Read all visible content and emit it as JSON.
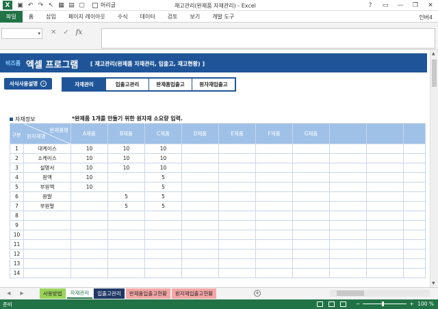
{
  "window": {
    "app_letter": "X",
    "title": "재고관리(완제품 자재관리) - Excel",
    "qat_checkbox_label": "머리글",
    "buttons": [
      "?",
      "▭",
      "—",
      "❐",
      "✕"
    ]
  },
  "ribbon": {
    "file": "파일",
    "tabs": [
      "홈",
      "삽입",
      "페이지 레이아웃",
      "수식",
      "데이터",
      "검토",
      "보기",
      "개발 도구"
    ],
    "user": "인버4"
  },
  "formula_bar": {
    "name_box": "",
    "cancel": "✕",
    "enter": "✓",
    "fx": "fx",
    "value": ""
  },
  "banner": {
    "logo_small": "비즈폼",
    "title": "엑셀 프로그램",
    "subtitle": "[ 재고관리(완제품 자재관리, 입출고, 재고현황) ]"
  },
  "help_button": {
    "label": "서식사용설명",
    "icon": "›"
  },
  "nav_buttons": [
    {
      "label": "자재관리",
      "active": true
    },
    {
      "label": "입출고관리",
      "active": false
    },
    {
      "label": "완제품입출고",
      "active": false
    },
    {
      "label": "원자재입출고",
      "active": false
    }
  ],
  "section": {
    "label": "자재정보",
    "note": "*완제품 1개를 만들기 위한 원자재 소요량 입력."
  },
  "table": {
    "corner_top": "완제품명",
    "corner_bottom": "원자재명",
    "corner_gubun": "구분",
    "product_columns": [
      "A제품",
      "B제품",
      "C제품",
      "D제품",
      "E제품",
      "F제품",
      "G제품",
      "",
      "",
      ""
    ],
    "rows": [
      {
        "no": "1",
        "name": "대케이스",
        "vals": [
          "10",
          "10",
          "10",
          "",
          "",
          "",
          "",
          "",
          "",
          ""
        ]
      },
      {
        "no": "2",
        "name": "소케이스",
        "vals": [
          "10",
          "10",
          "10",
          "",
          "",
          "",
          "",
          "",
          "",
          ""
        ]
      },
      {
        "no": "3",
        "name": "설명서",
        "vals": [
          "10",
          "10",
          "10",
          "",
          "",
          "",
          "",
          "",
          "",
          ""
        ]
      },
      {
        "no": "4",
        "name": "원액",
        "vals": [
          "10",
          "",
          "5",
          "",
          "",
          "",
          "",
          "",
          "",
          ""
        ]
      },
      {
        "no": "5",
        "name": "부원액",
        "vals": [
          "10",
          "",
          "5",
          "",
          "",
          "",
          "",
          "",
          "",
          ""
        ]
      },
      {
        "no": "6",
        "name": "원말",
        "vals": [
          "",
          "5",
          "5",
          "",
          "",
          "",
          "",
          "",
          "",
          ""
        ]
      },
      {
        "no": "7",
        "name": "부원말",
        "vals": [
          "",
          "5",
          "5",
          "",
          "",
          "",
          "",
          "",
          "",
          ""
        ]
      },
      {
        "no": "8",
        "name": "",
        "vals": [
          "",
          "",
          "",
          "",
          "",
          "",
          "",
          "",
          "",
          ""
        ]
      },
      {
        "no": "9",
        "name": "",
        "vals": [
          "",
          "",
          "",
          "",
          "",
          "",
          "",
          "",
          "",
          ""
        ]
      },
      {
        "no": "10",
        "name": "",
        "vals": [
          "",
          "",
          "",
          "",
          "",
          "",
          "",
          "",
          "",
          ""
        ]
      },
      {
        "no": "11",
        "name": "",
        "vals": [
          "",
          "",
          "",
          "",
          "",
          "",
          "",
          "",
          "",
          ""
        ]
      },
      {
        "no": "12",
        "name": "",
        "vals": [
          "",
          "",
          "",
          "",
          "",
          "",
          "",
          "",
          "",
          ""
        ]
      },
      {
        "no": "13",
        "name": "",
        "vals": [
          "",
          "",
          "",
          "",
          "",
          "",
          "",
          "",
          "",
          ""
        ]
      },
      {
        "no": "14",
        "name": "",
        "vals": [
          "",
          "",
          "",
          "",
          "",
          "",
          "",
          "",
          "",
          ""
        ]
      }
    ]
  },
  "sheet_tabs": [
    {
      "label": "사용방법",
      "bg": "#9bd35a",
      "fg": "#222222"
    },
    {
      "label": "자재관리",
      "bg": "#ffffff",
      "fg": "#217346"
    },
    {
      "label": "입출고관리",
      "bg": "#1f3864",
      "fg": "#ffffff"
    },
    {
      "label": "완제품입출고현황",
      "bg": "#f4a6a6",
      "fg": "#222222"
    },
    {
      "label": "원자재입출고현황",
      "bg": "#f4a6a6",
      "fg": "#222222"
    }
  ],
  "add_sheet": "+",
  "status": {
    "ready": "준비",
    "zoom": "100 %"
  },
  "colors": {
    "excel_green": "#217346",
    "banner_blue": "#1f5598",
    "header_blue": "#9fc1e7"
  }
}
